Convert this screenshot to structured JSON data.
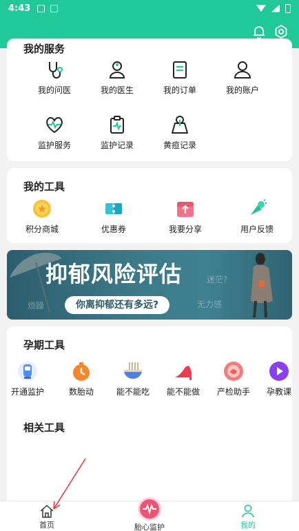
{
  "status_bar": {
    "time": "4:43"
  },
  "services": {
    "title": "我的服务",
    "items": [
      {
        "label": "我的问医",
        "icon": "stethoscope-icon"
      },
      {
        "label": "我的医生",
        "icon": "doctor-icon"
      },
      {
        "label": "我的订单",
        "icon": "order-icon"
      },
      {
        "label": "我的账户",
        "icon": "account-icon"
      },
      {
        "label": "监护服务",
        "icon": "heart-monitor-icon"
      },
      {
        "label": "监护记录",
        "icon": "clipboard-icon"
      },
      {
        "label": "黄疸记录",
        "icon": "jaundice-icon"
      }
    ]
  },
  "tools": {
    "title": "我的工具",
    "items": [
      {
        "label": "积分商城",
        "icon": "star-coin-icon"
      },
      {
        "label": "优惠券",
        "icon": "coupon-icon"
      },
      {
        "label": "我要分享",
        "icon": "share-icon"
      },
      {
        "label": "用户反馈",
        "icon": "feedback-icon"
      }
    ]
  },
  "banner": {
    "title": "抑郁风险评估",
    "subtitle": "你离抑郁还有多远?",
    "ghost_1": "烦躁",
    "ghost_2": "无力感",
    "ghost_3": "迷茫?"
  },
  "pregnancy": {
    "title": "孕期工具",
    "items": [
      {
        "label": "开通监护",
        "icon": "monitor-device-icon"
      },
      {
        "label": "数胎动",
        "icon": "timer-icon"
      },
      {
        "label": "能不能吃",
        "icon": "food-bowl-icon"
      },
      {
        "label": "能不能做",
        "icon": "high-heel-icon"
      },
      {
        "label": "产检助手",
        "icon": "checkup-icon"
      },
      {
        "label": "孕教课",
        "icon": "play-icon"
      }
    ]
  },
  "related": {
    "title": "相关工具"
  },
  "tabbar": {
    "home": "首页",
    "fetal": "胎心监护",
    "mine": "我的"
  },
  "colors": {
    "brand": "#20c997",
    "accent": "#ef5272"
  }
}
